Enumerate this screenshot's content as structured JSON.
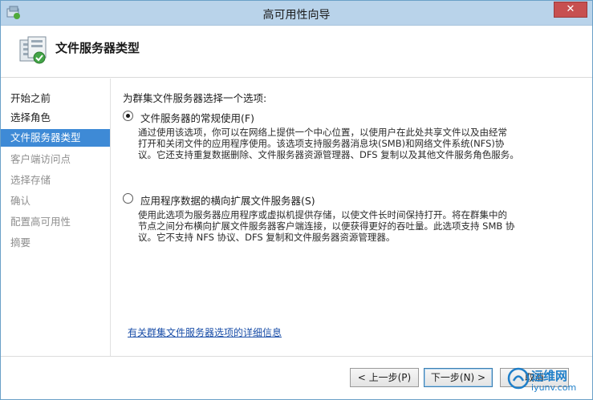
{
  "window": {
    "title": "高可用性向导",
    "close_label": "✕"
  },
  "header": {
    "title": "文件服务器类型"
  },
  "sidebar": {
    "items": [
      {
        "label": "开始之前",
        "state": "done"
      },
      {
        "label": "选择角色",
        "state": "done"
      },
      {
        "label": "文件服务器类型",
        "state": "current"
      },
      {
        "label": "客户端访问点",
        "state": "future"
      },
      {
        "label": "选择存储",
        "state": "future"
      },
      {
        "label": "确认",
        "state": "future"
      },
      {
        "label": "配置高可用性",
        "state": "future"
      },
      {
        "label": "摘要",
        "state": "future"
      }
    ]
  },
  "content": {
    "prompt": "为群集文件服务器选择一个选项:",
    "options": [
      {
        "label": "文件服务器的常规使用(F)",
        "checked": true,
        "desc_lines": [
          "通过使用该选项，你可以在网络上提供一个中心位置，以使用户在此处共享文件以及由经常",
          "打开和关闭文件的应用程序使用。该选项支持服务器消息块(SMB)和网络文件系统(NFS)协",
          "议。它还支持重复数据删除、文件服务器资源管理器、DFS 复制以及其他文件服务角色服务。"
        ]
      },
      {
        "label": "应用程序数据的横向扩展文件服务器(S)",
        "checked": false,
        "desc_lines": [
          "使用此选项为服务器应用程序或虚拟机提供存储，以使文件长时间保持打开。将在群集中的",
          "节点之间分布横向扩展文件服务器客户端连接，以便获得更好的吞吐量。此选项支持 SMB 协",
          "议。它不支持 NFS 协议、DFS 复制和文件服务器资源管理器。"
        ]
      }
    ],
    "more_info_link": "有关群集文件服务器选项的详细信息"
  },
  "footer": {
    "prev_label": "< 上一步(P)",
    "next_label": "下一步(N) >",
    "cancel_label": "取消"
  },
  "watermark": {
    "text": "运维网",
    "sub": "iyunv.com"
  },
  "colors": {
    "selected_nav": "#3e8ad6",
    "titlebar": "#b9d3ea",
    "link": "#1a4ea8",
    "close": "#c75050"
  }
}
